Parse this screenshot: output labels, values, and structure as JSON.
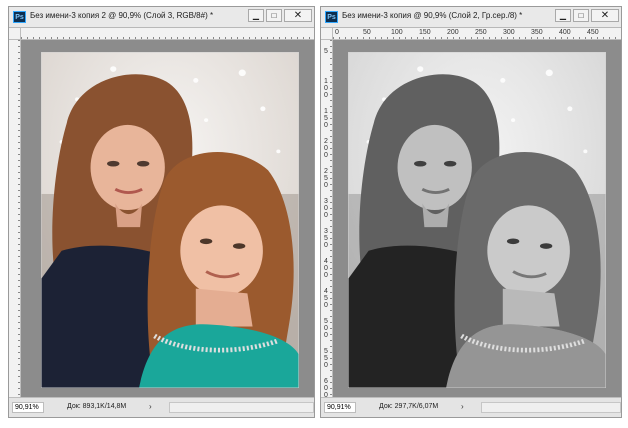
{
  "windows": [
    {
      "id": "left",
      "app_icon": "Ps",
      "title": "Без имени-3 копия 2 @ 90,9% (Слой 3, RGB/8#) *",
      "controls": {
        "minimize": "▁",
        "maximize": "□",
        "close": "✕"
      },
      "zoom": "90,91%",
      "doc_info": "Док: 893,1K/14,8M",
      "status_arrow": "›",
      "image_mode": "color"
    },
    {
      "id": "right",
      "app_icon": "Ps",
      "title": "Без имени-3 копия @ 90,9% (Слой 2, Гр.сер./8) *",
      "controls": {
        "minimize": "▁",
        "maximize": "□",
        "close": "✕"
      },
      "zoom": "90,91%",
      "doc_info": "Док: 297,7K/6,07M",
      "status_arrow": "›",
      "image_mode": "grayscale",
      "ruler_h_labels": [
        "0",
        "50",
        "100",
        "150",
        "200",
        "250",
        "300",
        "350",
        "400",
        "450"
      ],
      "ruler_v_labels": [
        "5",
        "1 0 0",
        "1 5 0",
        "2 0 0",
        "2 5 0",
        "3 0 0",
        "3 5 0",
        "4 0 0",
        "4 5 0",
        "5 0 0",
        "5 5 0",
        "6 0 0"
      ]
    }
  ],
  "colors": {
    "window_bg": "#d6d6d6",
    "canvas_bg": "#8c8c8c",
    "ps_icon_bg": "#0d2e4f",
    "ps_icon_fg": "#7fc4f5",
    "dress_teal": "#1aa79a"
  }
}
